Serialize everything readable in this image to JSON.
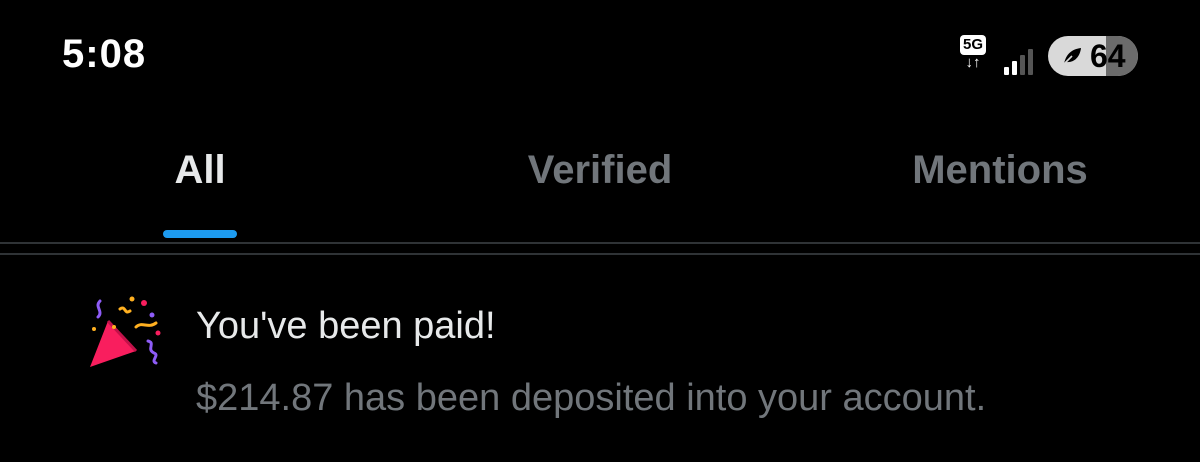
{
  "status_bar": {
    "time": "5:08",
    "network": "5G",
    "network_arrows": "↓↑",
    "signal_bars_active": 2,
    "signal_bars_total": 4,
    "battery_level": "64",
    "battery_fraction": 0.64,
    "battery_mode_icon": "leaf-icon"
  },
  "tabs": [
    {
      "label": "All",
      "active": true
    },
    {
      "label": "Verified",
      "active": false
    },
    {
      "label": "Mentions",
      "active": false
    }
  ],
  "colors": {
    "accent": "#1d9bf0",
    "background": "#000000",
    "text_primary": "#e7e9ea",
    "text_secondary": "#71767b",
    "divider": "#2f3336"
  },
  "notification": {
    "icon": "party-popper-icon",
    "title": "You've been paid!",
    "body": "$214.87 has been deposited into your account."
  }
}
